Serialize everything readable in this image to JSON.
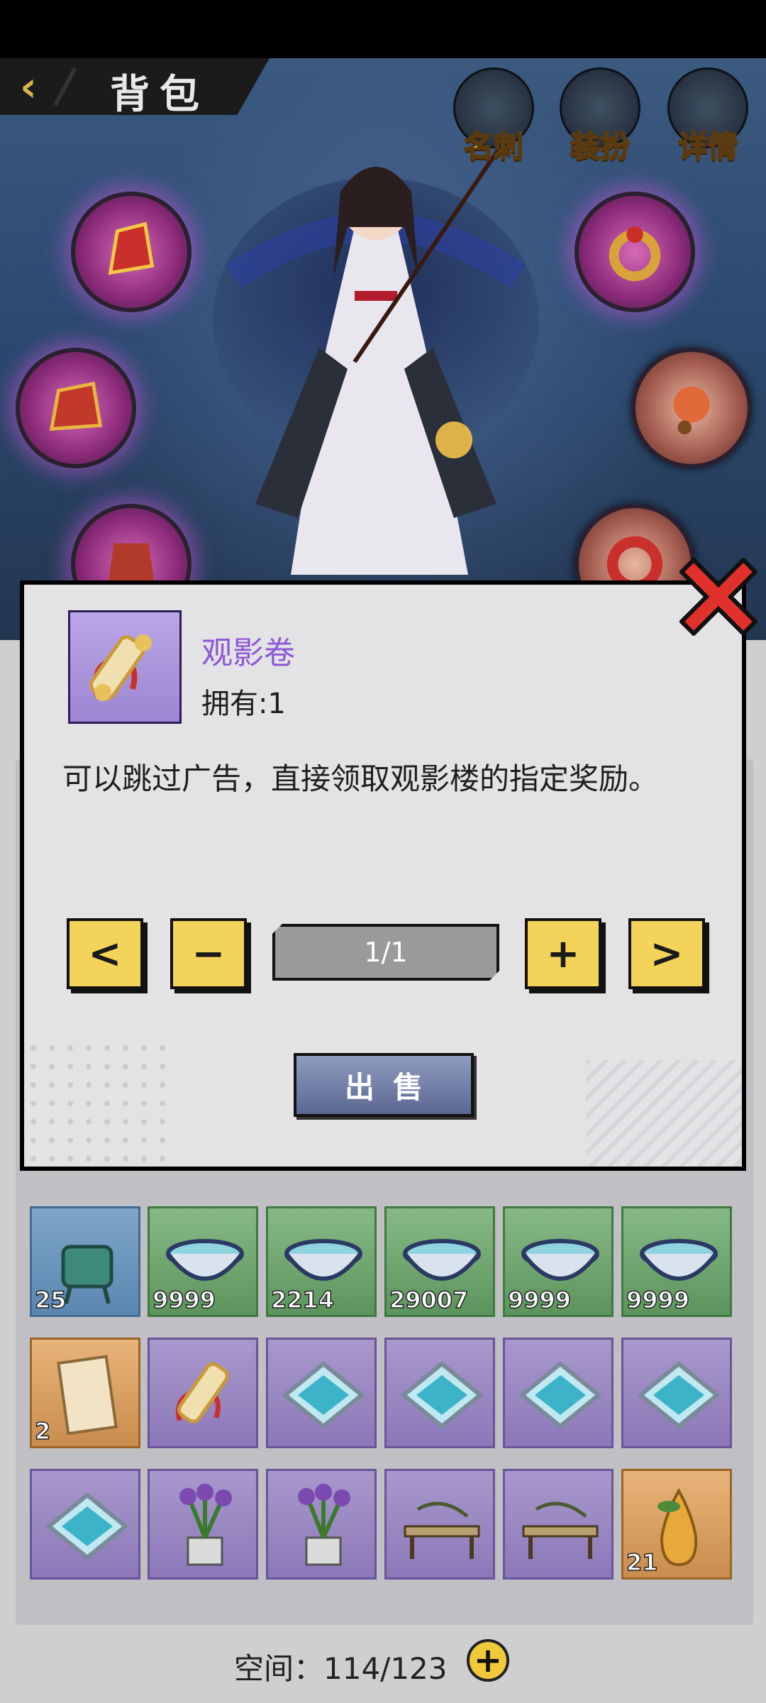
{
  "header": {
    "title": "背包",
    "buttons": [
      {
        "label": "名刺",
        "icon": "card-icon"
      },
      {
        "label": "装扮",
        "icon": "costume-icon"
      },
      {
        "label": "详情",
        "icon": "magnifier-icon"
      }
    ]
  },
  "dialog": {
    "item_name": "观影卷",
    "owned": "拥有:1",
    "description": "可以跳过广告，直接领取观影楼的指定奖励。",
    "quantity": "1/1",
    "prev": "<",
    "minus": "−",
    "plus": "+",
    "next": ">",
    "sell_label": "出售"
  },
  "inventory": {
    "rows": [
      [
        {
          "type": "cauldron",
          "rarity": "blue",
          "count": "25"
        },
        {
          "type": "bowl",
          "rarity": "green",
          "count": "9999"
        },
        {
          "type": "bowl",
          "rarity": "green",
          "count": "2214"
        },
        {
          "type": "bowl",
          "rarity": "green",
          "count": "29007"
        },
        {
          "type": "bowl",
          "rarity": "green",
          "count": "9999"
        },
        {
          "type": "bowl",
          "rarity": "green",
          "count": "9999"
        }
      ],
      [
        {
          "type": "letter",
          "rarity": "orange",
          "count": "2"
        },
        {
          "type": "scroll",
          "rarity": "purple",
          "count": ""
        },
        {
          "type": "pool",
          "rarity": "purple",
          "count": ""
        },
        {
          "type": "pool",
          "rarity": "purple",
          "count": ""
        },
        {
          "type": "pool",
          "rarity": "purple",
          "count": ""
        },
        {
          "type": "pool",
          "rarity": "purple",
          "count": ""
        }
      ],
      [
        {
          "type": "pool",
          "rarity": "purple",
          "count": ""
        },
        {
          "type": "flower",
          "rarity": "purple",
          "count": ""
        },
        {
          "type": "flower",
          "rarity": "purple",
          "count": ""
        },
        {
          "type": "table",
          "rarity": "purple",
          "count": ""
        },
        {
          "type": "table",
          "rarity": "purple",
          "count": ""
        },
        {
          "type": "pear",
          "rarity": "orange",
          "count": "21"
        }
      ]
    ],
    "space_label": "空间：114/123"
  },
  "colors": {
    "accent_yellow": "#f4d35a",
    "item_name_purple": "#8e57d8",
    "close_red": "#e0302c"
  }
}
